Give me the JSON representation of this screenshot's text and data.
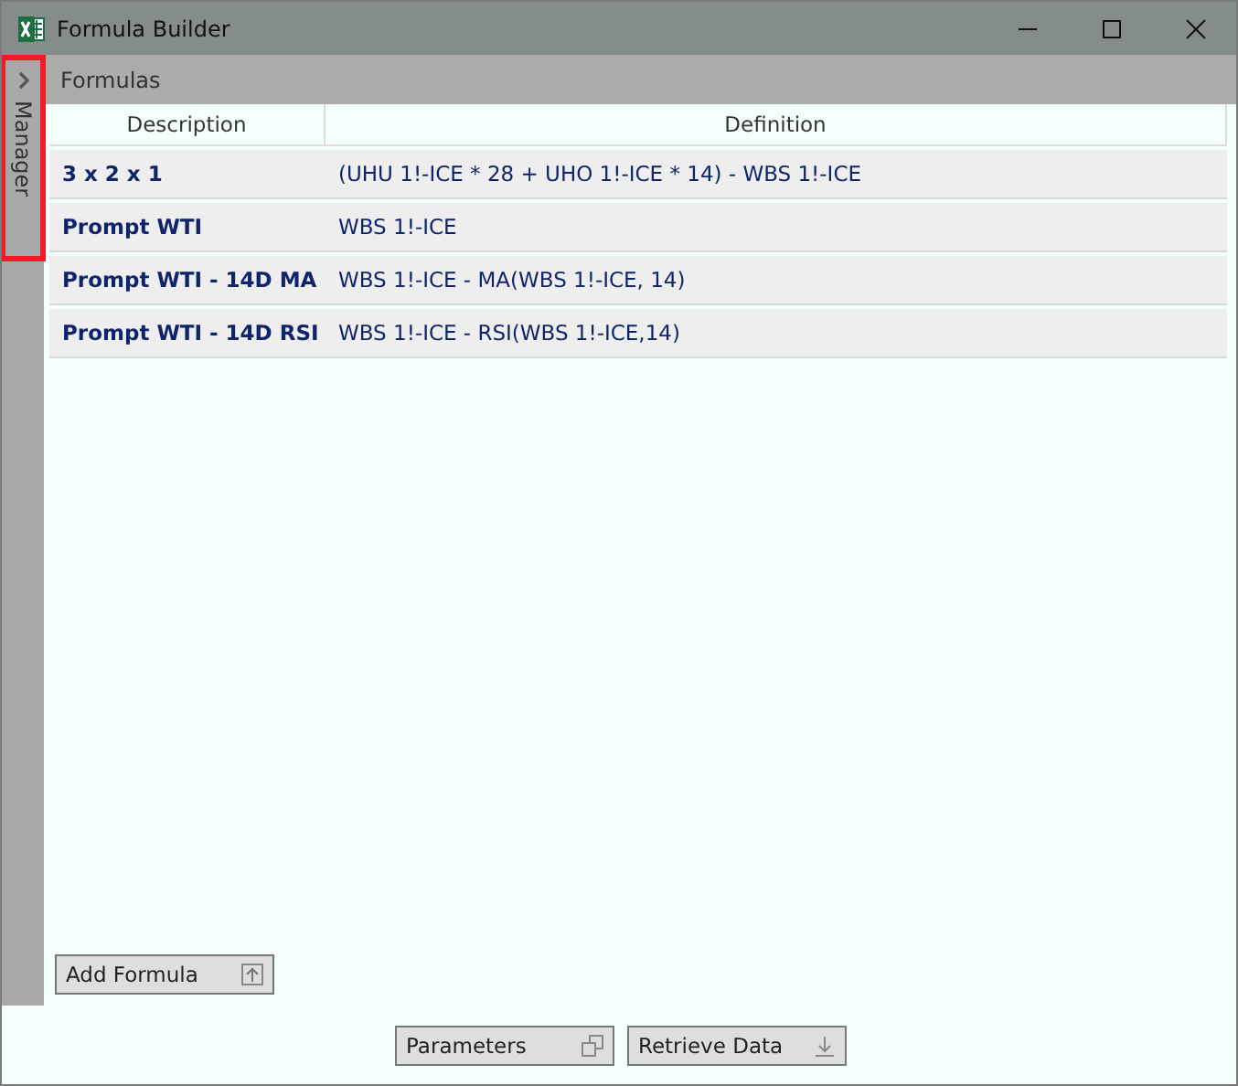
{
  "window": {
    "title": "Formula Builder"
  },
  "side_tab": {
    "label": "Manager",
    "highlighted": true
  },
  "panel": {
    "title": "Formulas"
  },
  "table": {
    "columns": [
      "Description",
      "Definition"
    ],
    "rows": [
      [
        "3 x 2 x 1",
        "(UHU 1!-ICE * 28 + UHO 1!-ICE * 14) - WBS 1!-ICE"
      ],
      [
        "Prompt WTI",
        "WBS 1!-ICE"
      ],
      [
        "Prompt WTI - 14D MA",
        "WBS 1!-ICE - MA(WBS 1!-ICE, 14)"
      ],
      [
        "Prompt WTI - 14D RSI",
        "WBS 1!-ICE - RSI(WBS 1!-ICE,14)"
      ]
    ]
  },
  "add_button": {
    "label": "Add Formula",
    "kind": "upload"
  },
  "footer_buttons": [
    {
      "label": "Parameters",
      "kind": "copy"
    },
    {
      "label": "Retrieve Data",
      "kind": "download"
    }
  ]
}
